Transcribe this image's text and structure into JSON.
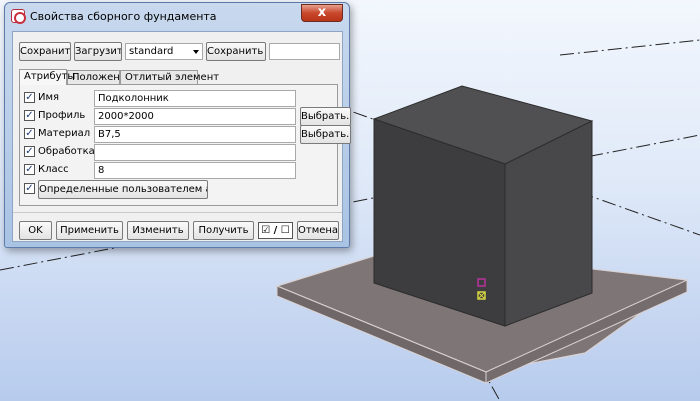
{
  "window": {
    "title": "Свойства сборного фундамента",
    "close_label": "x"
  },
  "toolbar": {
    "save_label": "Сохранить",
    "load_label": "Загрузить",
    "preset_value": "standard",
    "save_as_label": "Сохранить как",
    "save_as_value": ""
  },
  "tabs": [
    {
      "label": "Атрибуты"
    },
    {
      "label": "Положение"
    },
    {
      "label": "Отлитый элемент"
    }
  ],
  "attributes": {
    "name": {
      "label": "Имя",
      "value": "Подколонник",
      "checked": "✓"
    },
    "profile": {
      "label": "Профиль",
      "value": "2000*2000",
      "checked": "✓",
      "select_label": "Выбрать..."
    },
    "material": {
      "label": "Материал",
      "value": "B7,5",
      "checked": "✓",
      "select_label": "Выбрать..."
    },
    "finish": {
      "label": "Обработка",
      "value": "",
      "checked": "✓"
    },
    "class": {
      "label": "Класс",
      "value": "8",
      "checked": "✓"
    },
    "user_attrs": {
      "label": "Определенные пользователем атрибуты...",
      "checked": "✓"
    }
  },
  "footer": {
    "ok_label": "OK",
    "apply_label": "Применить",
    "modify_label": "Изменить",
    "get_label": "Получить",
    "toggle_label": "☑ / ☐",
    "cancel_label": "Отмена"
  },
  "colors": {
    "block_top": "#505052",
    "block_left": "#3c3c3e",
    "block_right": "#47474a",
    "slab_top": "#7d7576",
    "handle_magenta": "#b8339a",
    "handle_yellow": "#d8d640"
  }
}
